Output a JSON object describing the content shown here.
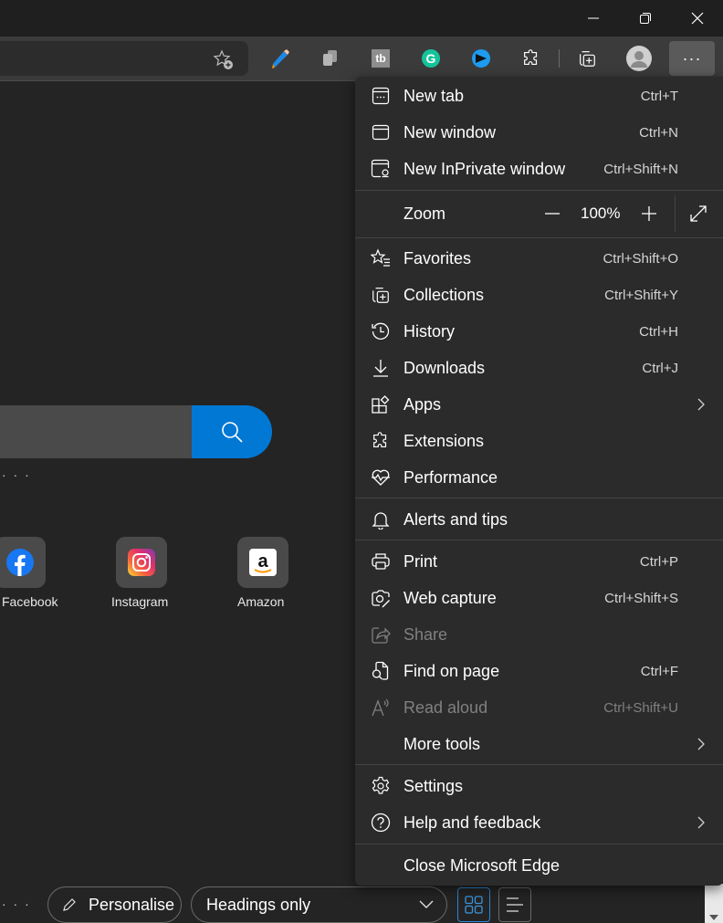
{
  "window": {
    "controls": [
      "minimize",
      "restore",
      "close"
    ]
  },
  "toolbar": {
    "add_favorite_icon": "star-plus-icon",
    "extensions": [
      {
        "name": "pencil-extension",
        "icon": "pencil-icon"
      },
      {
        "name": "copy-extension",
        "icon": "copy-icon"
      },
      {
        "name": "tb-extension",
        "icon": "tb-icon",
        "text": "tb"
      },
      {
        "name": "grammarly-extension",
        "icon": "grammarly-icon",
        "text": "G"
      },
      {
        "name": "ia-extension",
        "icon": "ia-icon"
      }
    ],
    "extensions_button_icon": "puzzle-icon",
    "collections_icon": "collections-icon",
    "profile_icon": "avatar",
    "menu_button_label": "···"
  },
  "ntp": {
    "search_icon": "search-icon",
    "more_dots": "· · ·",
    "tiles": [
      {
        "label": "Facebook",
        "icon": "facebook-icon",
        "color": "#1877f2"
      },
      {
        "label": "Instagram",
        "icon": "instagram-icon",
        "color": "#e1306c"
      },
      {
        "label": "Amazon",
        "icon": "amazon-icon",
        "color": "#ff9900"
      }
    ],
    "bottom": {
      "dots": "· · ·",
      "personalise_label": "Personalise",
      "layout_select_value": "Headings only",
      "grid_view_icon": "grid-icon",
      "list_view_icon": "list-icon"
    }
  },
  "menu": {
    "items": [
      {
        "label": "New tab",
        "shortcut": "Ctrl+T",
        "icon": "new-tab-icon"
      },
      {
        "label": "New window",
        "shortcut": "Ctrl+N",
        "icon": "new-window-icon"
      },
      {
        "label": "New InPrivate window",
        "shortcut": "Ctrl+Shift+N",
        "icon": "inprivate-icon"
      },
      {
        "label": "Favorites",
        "shortcut": "Ctrl+Shift+O",
        "icon": "favorites-icon"
      },
      {
        "label": "Collections",
        "shortcut": "Ctrl+Shift+Y",
        "icon": "collections-icon"
      },
      {
        "label": "History",
        "shortcut": "Ctrl+H",
        "icon": "history-icon"
      },
      {
        "label": "Downloads",
        "shortcut": "Ctrl+J",
        "icon": "download-icon"
      },
      {
        "label": "Apps",
        "shortcut": "",
        "icon": "apps-icon",
        "submenu": true
      },
      {
        "label": "Extensions",
        "shortcut": "",
        "icon": "puzzle-icon"
      },
      {
        "label": "Performance",
        "shortcut": "",
        "icon": "heartbeat-icon"
      },
      {
        "label": "Alerts and tips",
        "shortcut": "",
        "icon": "bell-icon"
      },
      {
        "label": "Print",
        "shortcut": "Ctrl+P",
        "icon": "printer-icon"
      },
      {
        "label": "Web capture",
        "shortcut": "Ctrl+Shift+S",
        "icon": "web-capture-icon"
      },
      {
        "label": "Share",
        "shortcut": "",
        "icon": "share-icon",
        "disabled": true
      },
      {
        "label": "Find on page",
        "shortcut": "Ctrl+F",
        "icon": "find-icon"
      },
      {
        "label": "Read aloud",
        "shortcut": "Ctrl+Shift+U",
        "icon": "read-aloud-icon",
        "disabled": true
      },
      {
        "label": "More tools",
        "shortcut": "",
        "icon": "",
        "submenu": true
      },
      {
        "label": "Settings",
        "shortcut": "",
        "icon": "gear-icon"
      },
      {
        "label": "Help and feedback",
        "shortcut": "",
        "icon": "help-icon",
        "submenu": true
      },
      {
        "label": "Close Microsoft Edge",
        "shortcut": "",
        "icon": ""
      }
    ],
    "zoom": {
      "label": "Zoom",
      "value": "100%",
      "decrease": "—",
      "increase": "+",
      "fullscreen_icon": "fullscreen-icon"
    }
  }
}
